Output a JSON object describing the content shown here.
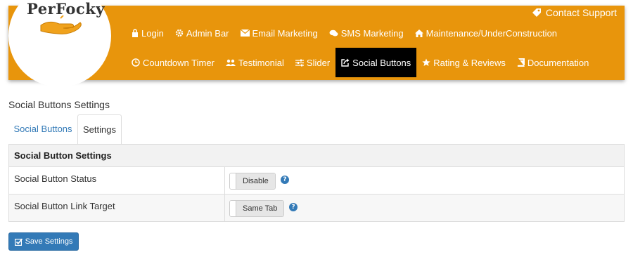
{
  "brand": {
    "logo_text": "PerFocky"
  },
  "header": {
    "contact_label": "Contact Support"
  },
  "nav": {
    "row1": [
      {
        "label": "Login",
        "icon": "lock-icon"
      },
      {
        "label": "Admin Bar",
        "icon": "gear-icon"
      },
      {
        "label": "Email Marketing",
        "icon": "envelope-icon"
      },
      {
        "label": "SMS Marketing",
        "icon": "chat-icon"
      },
      {
        "label": "Maintenance/UnderConstruction",
        "icon": "home-icon"
      }
    ],
    "row2": [
      {
        "label": "Countdown Timer",
        "icon": "clock-icon"
      },
      {
        "label": "Testimonial",
        "icon": "users-icon"
      },
      {
        "label": "Slider",
        "icon": "sliders-icon"
      },
      {
        "label": "Social Buttons",
        "icon": "share-icon",
        "active": true
      },
      {
        "label": "Rating & Reviews",
        "icon": "star-icon"
      },
      {
        "label": "Documentation",
        "icon": "book-icon"
      }
    ]
  },
  "page": {
    "title": "Social Buttons Settings"
  },
  "tabs": [
    {
      "label": "Social Buttons",
      "active": false
    },
    {
      "label": "Settings",
      "active": true
    }
  ],
  "settings": {
    "header": "Social Button Settings",
    "rows": [
      {
        "label": "Social Button Status",
        "value": "Disable"
      },
      {
        "label": "Social Button Link Target",
        "value": "Same Tab"
      }
    ]
  },
  "actions": {
    "save_label": "Save Settings"
  },
  "colors": {
    "header_bg": "#e8950c",
    "link": "#337ab7",
    "active_nav": "#000000"
  }
}
